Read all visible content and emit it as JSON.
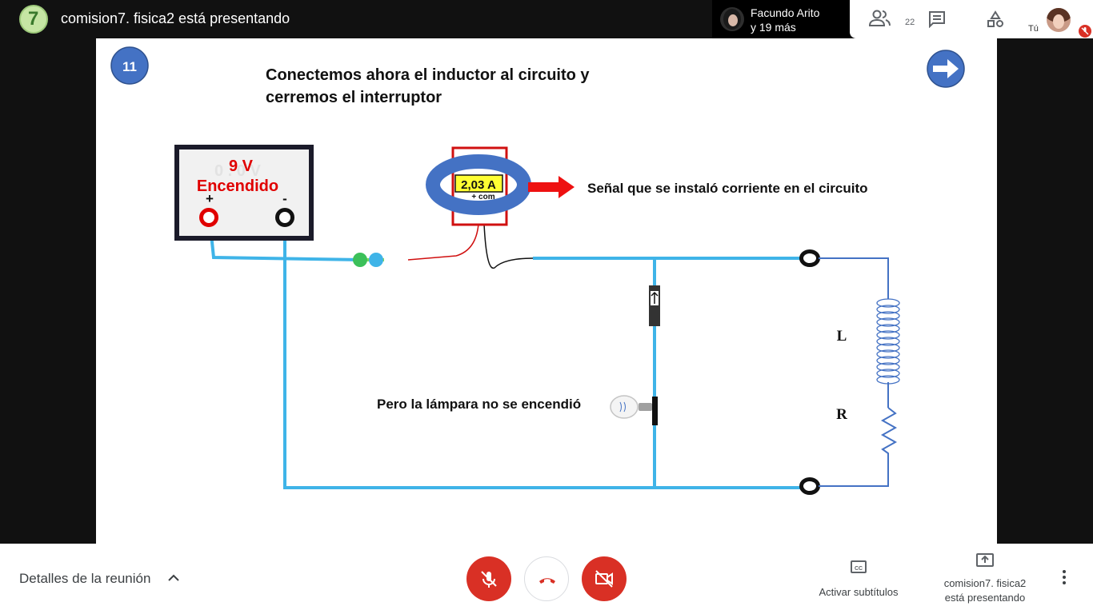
{
  "header": {
    "title": "comision7. fisica2 está presentando",
    "participant_name": "Facundo Arito",
    "participant_more": "y 19 más",
    "participant_count": "22",
    "self_label": "Tú"
  },
  "slide": {
    "number": "11",
    "title_line1": "Conectemos ahora el inductor al circuito y",
    "title_line2": "cerremos el interruptor",
    "supply_voltage_ghost": "0 . 0 V",
    "supply_voltage": "9 V",
    "supply_status": "Encendido",
    "plus_label": "+",
    "minus_label": "-",
    "ammeter_reading": "2,03 A",
    "ammeter_terminals": "+ com",
    "arrow_note": "Señal que se instaló corriente en el circuito",
    "lamp_note": "Pero la lámpara no se encendió",
    "inductor_label": "L",
    "resistor_label": "R"
  },
  "bottom": {
    "meeting_details": "Detalles de la reunión",
    "captions": "Activar subtítulos",
    "presenting_line1": "comision7. fisica2",
    "presenting_line2": "está presentando"
  },
  "colors": {
    "wire": "#3fb4e8",
    "mic_off": "#d93025",
    "slide_number_bg": "#4472c4",
    "coil": "#4472c4",
    "arrow": "#ee1111"
  },
  "icons": [
    "people-icon",
    "chat-icon",
    "activities-icon",
    "mic-off-icon",
    "hangup-icon",
    "camera-off-icon",
    "captions-icon",
    "present-icon",
    "more-vert-icon",
    "next-arrow-icon",
    "chevron-up-icon"
  ]
}
